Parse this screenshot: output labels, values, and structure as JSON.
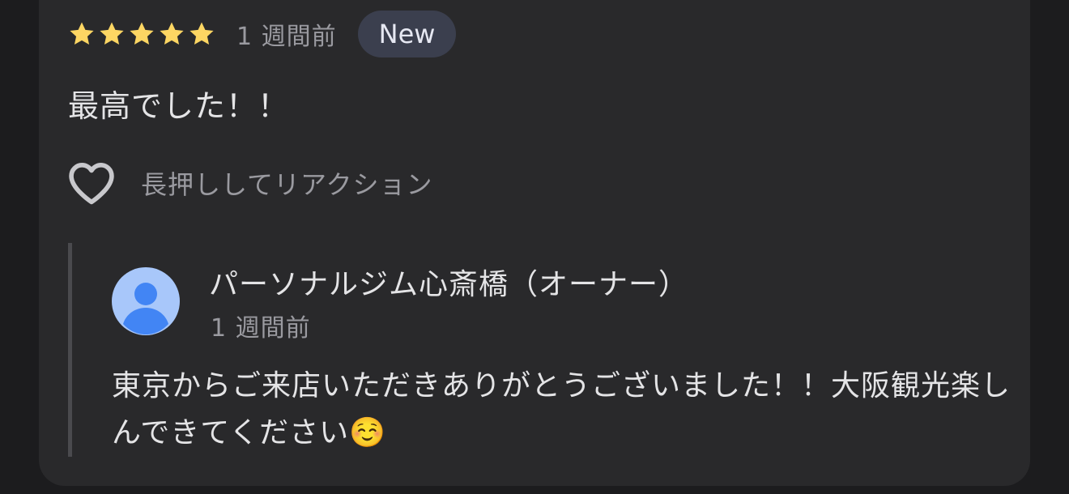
{
  "review": {
    "rating": 5,
    "rating_max": 5,
    "time": "1 週間前",
    "badge": "New",
    "text": "最高でした！！",
    "reaction_label": "長押ししてリアクション"
  },
  "owner_reply": {
    "name": "パーソナルジム心斎橋（オーナー）",
    "time": "1 週間前",
    "text": "東京からご来店いただきありがとうございました！！大阪観光楽しんできてください☺️"
  },
  "colors": {
    "star": "#fdd663",
    "card_bg": "#29292b",
    "badge_bg": "#3b3f4e",
    "avatar_bg": "#a8c7fa",
    "avatar_fg": "#4285f4"
  },
  "icons": {
    "star": "star-icon",
    "heart": "heart-icon",
    "avatar": "person-icon"
  }
}
